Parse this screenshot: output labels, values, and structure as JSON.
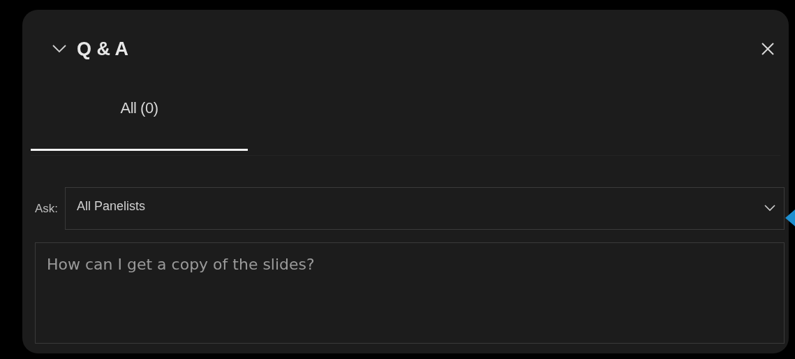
{
  "panel": {
    "title": "Q & A",
    "expanded": true
  },
  "tabs": [
    {
      "label": "All (0)",
      "selected": true
    }
  ],
  "ask": {
    "label": "Ask:",
    "value": "All Panelists"
  },
  "question": {
    "placeholder": "How can I get a copy of the slides?"
  }
}
